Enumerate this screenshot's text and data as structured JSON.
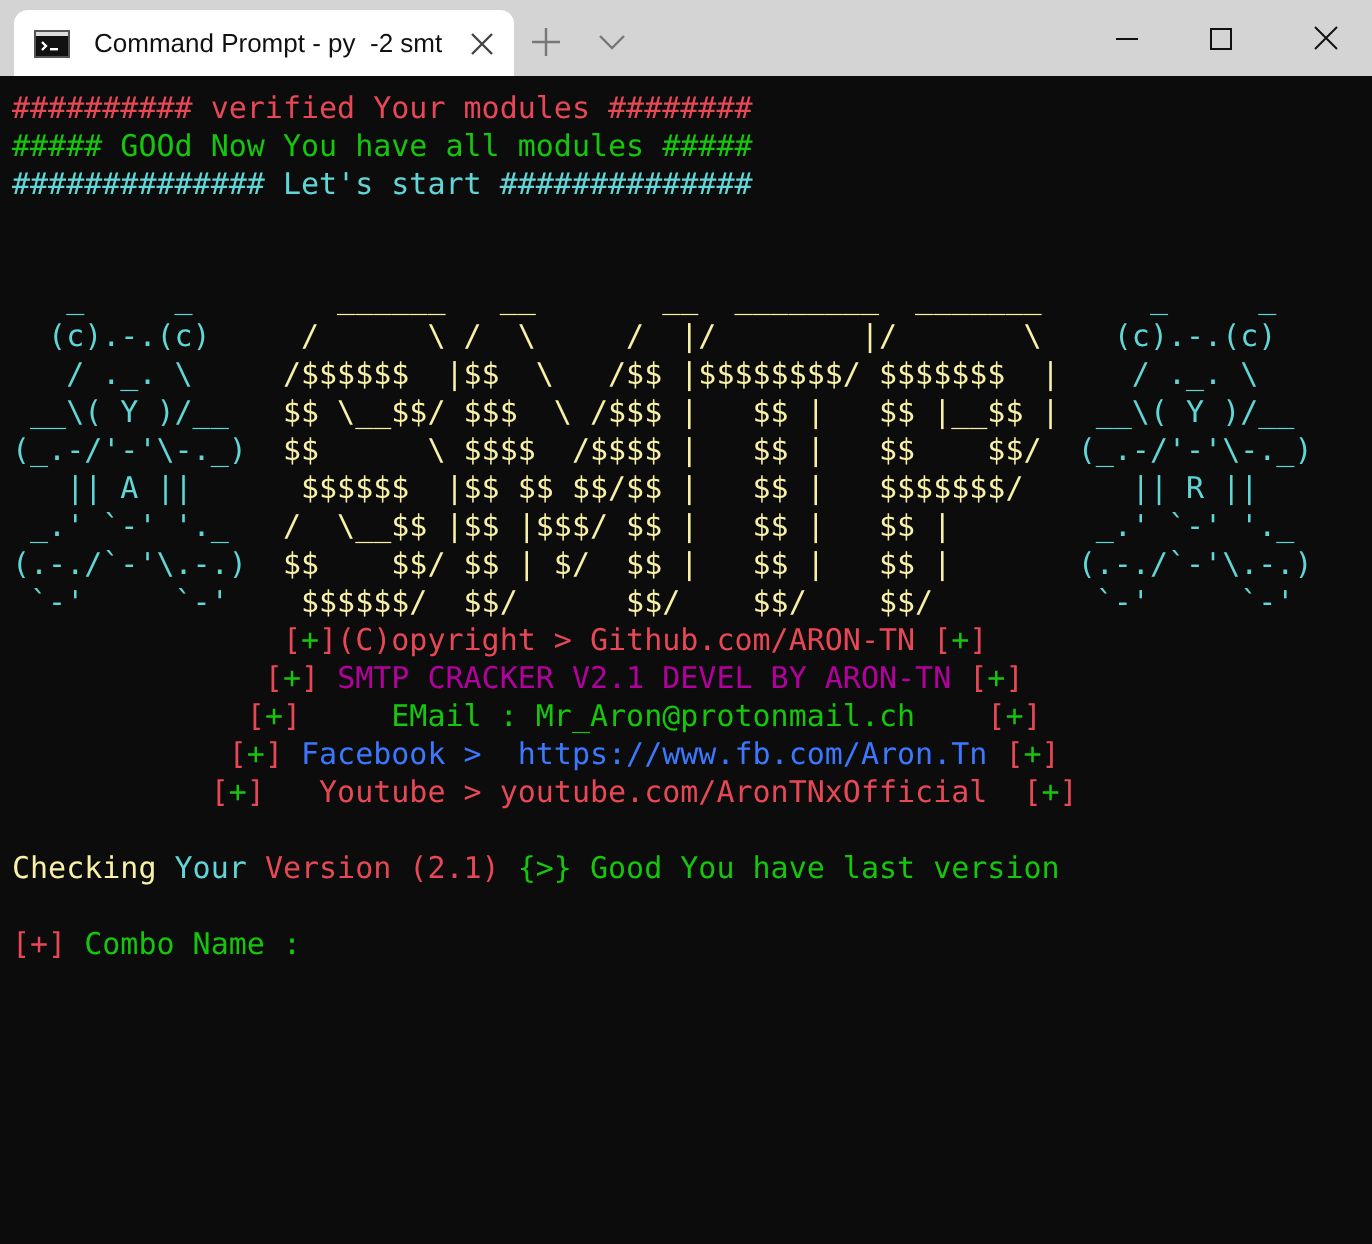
{
  "window": {
    "tab": {
      "title": "Command Prompt - py  -2 smt",
      "selected": true
    }
  },
  "console": [
    {
      "kind": "text",
      "segments": [
        {
          "text": "########## verified Your modules ########",
          "color": "#e74856"
        }
      ]
    },
    {
      "kind": "text",
      "segments": [
        {
          "text": "##### GOOd Now You have all modules #####",
          "color": "#16c60c"
        }
      ]
    },
    {
      "kind": "text",
      "segments": [
        {
          "text": "############## Let's start ##############",
          "color": "#61d6d6"
        }
      ]
    },
    {
      "kind": "blank"
    },
    {
      "kind": "blank"
    },
    {
      "kind": "art",
      "segments": [
        {
          "text": "   _     _    ",
          "color": "#61d6d6"
        },
        {
          "text": "    ______   __       __  ________  _______   ",
          "color": "#f9f1a5"
        },
        {
          "text": "   _     _",
          "color": "#61d6d6"
        }
      ]
    },
    {
      "kind": "art",
      "segments": [
        {
          "text": "  (c).-.(c)    ",
          "color": "#61d6d6"
        },
        {
          "text": " /      \\ /  \\     /  |/        |/       \\  ",
          "color": "#f9f1a5"
        },
        {
          "text": "  (c).-.(c)",
          "color": "#61d6d6"
        }
      ]
    },
    {
      "kind": "art",
      "segments": [
        {
          "text": "   / ._. \\     ",
          "color": "#61d6d6"
        },
        {
          "text": "/$$$$$$  |$$  \\   /$$ |$$$$$$$$/ $$$$$$$  | ",
          "color": "#f9f1a5"
        },
        {
          "text": "   / ._. \\",
          "color": "#61d6d6"
        }
      ]
    },
    {
      "kind": "art",
      "segments": [
        {
          "text": " __\\( Y )/__   ",
          "color": "#61d6d6"
        },
        {
          "text": "$$ \\__$$/ $$$  \\ /$$$ |   $$ |   $$ |__$$ | ",
          "color": "#f9f1a5"
        },
        {
          "text": " __\\( Y )/__",
          "color": "#61d6d6"
        }
      ]
    },
    {
      "kind": "art",
      "segments": [
        {
          "text": "(_.-/'-'\\-._)  ",
          "color": "#61d6d6"
        },
        {
          "text": "$$      \\ $$$$  /$$$$ |   $$ |   $$    $$/  ",
          "color": "#f9f1a5"
        },
        {
          "text": "(_.-/'-'\\-._)",
          "color": "#61d6d6"
        }
      ]
    },
    {
      "kind": "art",
      "segments": [
        {
          "text": "   || A ||     ",
          "color": "#61d6d6"
        },
        {
          "text": " $$$$$$  |$$ $$ $$/$$ |   $$ |   $$$$$$$/   ",
          "color": "#f9f1a5"
        },
        {
          "text": "   || R ||",
          "color": "#61d6d6"
        }
      ]
    },
    {
      "kind": "art",
      "segments": [
        {
          "text": " _.' `-' '._   ",
          "color": "#61d6d6"
        },
        {
          "text": "/  \\__$$ |$$ |$$$/ $$ |   $$ |   $$ |       ",
          "color": "#f9f1a5"
        },
        {
          "text": " _.' `-' '._",
          "color": "#61d6d6"
        }
      ]
    },
    {
      "kind": "art",
      "segments": [
        {
          "text": "(.-./`-'\\.-.)  ",
          "color": "#61d6d6"
        },
        {
          "text": "$$    $$/ $$ | $/  $$ |   $$ |   $$ |       ",
          "color": "#f9f1a5"
        },
        {
          "text": "(.-./`-'\\.-.)",
          "color": "#61d6d6"
        }
      ]
    },
    {
      "kind": "art",
      "segments": [
        {
          "text": " `-'     `-'   ",
          "color": "#61d6d6"
        },
        {
          "text": " $$$$$$/  $$/      $$/    $$/    $$/        ",
          "color": "#f9f1a5"
        },
        {
          "text": " `-'     `-'",
          "color": "#61d6d6"
        }
      ]
    },
    {
      "kind": "text",
      "segments": [
        {
          "text": "               [",
          "color": "#e74856"
        },
        {
          "text": "+",
          "color": "#16c60c"
        },
        {
          "text": "](C)opyright > Github.com/ARON-TN [",
          "color": "#e74856"
        },
        {
          "text": "+",
          "color": "#16c60c"
        },
        {
          "text": "]",
          "color": "#e74856"
        }
      ]
    },
    {
      "kind": "text",
      "segments": [
        {
          "text": "              [",
          "color": "#e74856"
        },
        {
          "text": "+",
          "color": "#16c60c"
        },
        {
          "text": "] ",
          "color": "#e74856"
        },
        {
          "text": "SMTP CRACKER V2.1 DEVEL BY ARON-TN",
          "color": "#b4009e"
        },
        {
          "text": " [",
          "color": "#e74856"
        },
        {
          "text": "+",
          "color": "#16c60c"
        },
        {
          "text": "]",
          "color": "#e74856"
        }
      ]
    },
    {
      "kind": "text",
      "segments": [
        {
          "text": "             [",
          "color": "#e74856"
        },
        {
          "text": "+",
          "color": "#16c60c"
        },
        {
          "text": "]     ",
          "color": "#e74856"
        },
        {
          "text": "EMail : Mr_Aron@protonmail.ch",
          "color": "#16c60c"
        },
        {
          "text": "    [",
          "color": "#e74856"
        },
        {
          "text": "+",
          "color": "#16c60c"
        },
        {
          "text": "]",
          "color": "#e74856"
        }
      ]
    },
    {
      "kind": "text",
      "segments": [
        {
          "text": "            [",
          "color": "#e74856"
        },
        {
          "text": "+",
          "color": "#16c60c"
        },
        {
          "text": "] ",
          "color": "#e74856"
        },
        {
          "text": "Facebook >  https://www.fb.com/Aron.Tn",
          "color": "#3b78ff"
        },
        {
          "text": " [",
          "color": "#e74856"
        },
        {
          "text": "+",
          "color": "#16c60c"
        },
        {
          "text": "]",
          "color": "#e74856"
        }
      ]
    },
    {
      "kind": "text",
      "segments": [
        {
          "text": "           [",
          "color": "#e74856"
        },
        {
          "text": "+",
          "color": "#16c60c"
        },
        {
          "text": "]   Youtube > youtube.com/AronTNxOfficial  [",
          "color": "#e74856"
        },
        {
          "text": "+",
          "color": "#16c60c"
        },
        {
          "text": "]",
          "color": "#e74856"
        }
      ]
    },
    {
      "kind": "blank"
    },
    {
      "kind": "text",
      "segments": [
        {
          "text": "Checking ",
          "color": "#f9f1a5"
        },
        {
          "text": "Your ",
          "color": "#61d6d6"
        },
        {
          "text": "Version (2.1) ",
          "color": "#e74856"
        },
        {
          "text": "{>} Good You have last version",
          "color": "#16c60c"
        }
      ]
    },
    {
      "kind": "blank"
    },
    {
      "kind": "text",
      "segments": [
        {
          "text": "[+]",
          "color": "#e74856"
        },
        {
          "text": " Combo Name :",
          "color": "#16c60c"
        }
      ]
    }
  ]
}
